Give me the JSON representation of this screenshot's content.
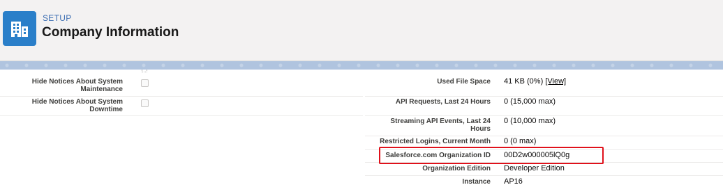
{
  "header": {
    "breadcrumb": "SETUP",
    "title": "Company Information",
    "icon": "building-icon"
  },
  "left_fields": [
    {
      "label": "Hide Notices About System Maintenance",
      "checked": false
    },
    {
      "label": "Hide Notices About System Downtime",
      "checked": false
    }
  ],
  "right_fields": [
    {
      "label": "Used File Space",
      "value": "41 KB (0%)",
      "link": "[View]"
    },
    {
      "label": "API Requests, Last 24 Hours",
      "value": "0 (15,000 max)"
    },
    {
      "label": "Streaming API Events, Last 24 Hours",
      "value": "0 (10,000 max)"
    },
    {
      "label": "Restricted Logins, Current Month",
      "value": "0 (0 max)"
    },
    {
      "label": "Salesforce.com Organization ID",
      "value": "00D2w000005lQ0g"
    },
    {
      "label": "Organization Edition",
      "value": "Developer Edition"
    },
    {
      "label": "Instance",
      "value": "AP16"
    }
  ],
  "colors": {
    "highlight_box": "#e0111b",
    "app_icon_bg": "#2a7fc9"
  }
}
